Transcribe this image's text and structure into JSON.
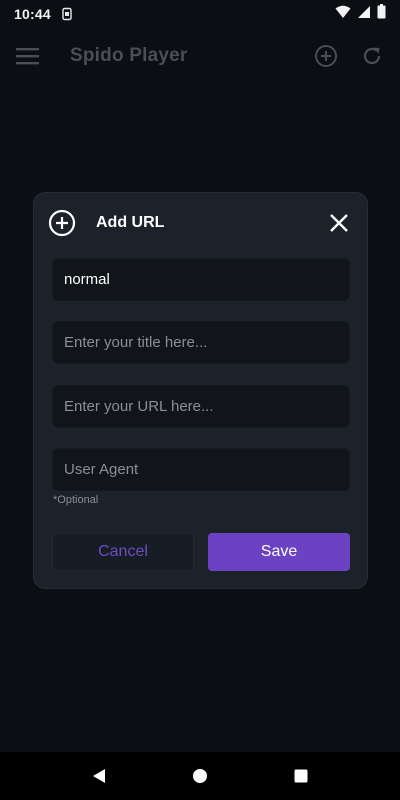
{
  "status_bar": {
    "time": "10:44",
    "icons": [
      "sim-card-icon",
      "wifi-icon",
      "signal-icon",
      "battery-icon"
    ]
  },
  "app_bar": {
    "title": "Spido Player",
    "icons": [
      "menu-icon",
      "add-circle-icon",
      "refresh-icon"
    ]
  },
  "dialog": {
    "title": "Add URL",
    "icons": [
      "add-circle-icon",
      "close-icon"
    ],
    "fields": {
      "type_value": "normal",
      "title_placeholder": "Enter your title here...",
      "url_placeholder": "Enter your URL here...",
      "user_agent_placeholder": "User Agent"
    },
    "optional_note": "*Optional",
    "cancel_label": "Cancel",
    "save_label": "Save"
  },
  "nav_bar": {
    "icons": [
      "back-triangle-icon",
      "home-circle-icon",
      "recents-square-icon"
    ]
  },
  "colors": {
    "background": "#0b0e12",
    "dialog": "#1b222a",
    "field": "#11151a",
    "accent": "#6a42c2",
    "accent_text": "#6e4cc4"
  }
}
